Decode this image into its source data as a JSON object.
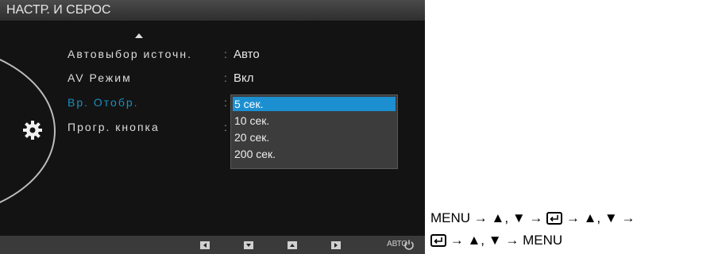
{
  "osd": {
    "title": "НАСТР. И СБРОС",
    "rows": [
      {
        "label": "Автовыбор источн.",
        "value": "Авто"
      },
      {
        "label": "AV Режим",
        "value": "Вкл"
      },
      {
        "label": "Вр. Отобр.",
        "value": ""
      },
      {
        "label": "Прогр. кнопка",
        "value": ""
      }
    ],
    "colon": ":",
    "dropdown": {
      "options": [
        "5 сек.",
        "10 сек.",
        "20 сек.",
        "200 сек."
      ],
      "selected": "5 сек."
    },
    "bottom_bar": {
      "auto_label": "АВТО"
    },
    "colors": {
      "highlight": "#1c8fd0",
      "selected_label": "#1a8fbf"
    }
  },
  "instructions": {
    "line1_menu": "MENU",
    "line2_menu": "MENU",
    "arrow": "→",
    "sep": ","
  }
}
